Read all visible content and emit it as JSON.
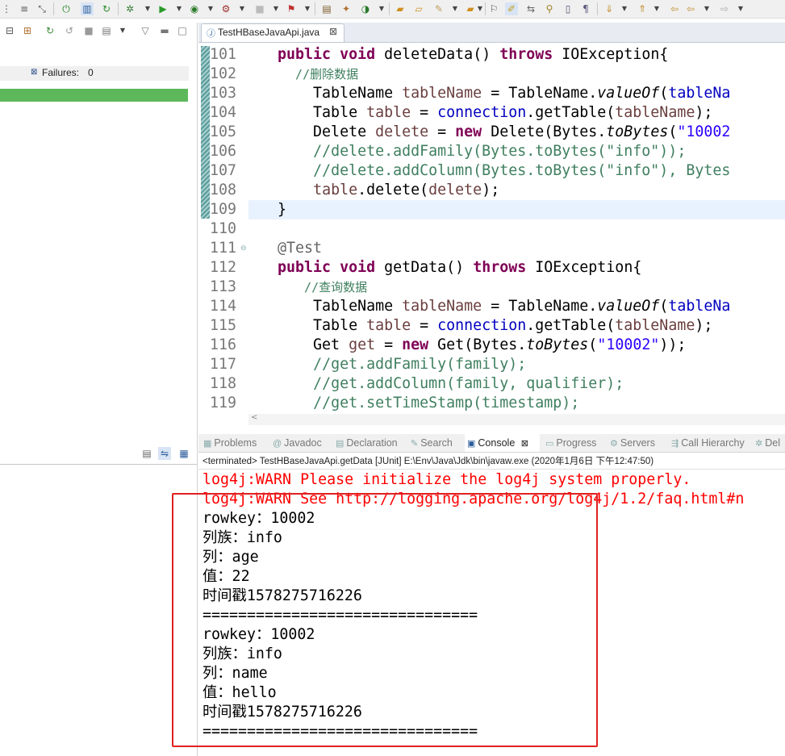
{
  "toolbar": {
    "icons": [
      "prev-edit-icon",
      "next-annotation-icon",
      "power-icon",
      "columns-icon",
      "refresh-icon",
      "debug-icon",
      "run-icon",
      "run-external-icon",
      "coverage-icon",
      "stop-icon",
      "new-server-icon",
      "pin-icon",
      "package-icon",
      "new-class-icon",
      "open-type-icon",
      "open-folder-icon",
      "search-icon",
      "task-icon",
      "open-icon",
      "bookmark-icon",
      "highlight-icon",
      "link-icon",
      "mark-icon",
      "block-icon",
      "pilcrow-icon",
      "next-arrow-icon",
      "prev-arrow-icon",
      "back-icon",
      "forward-icon"
    ]
  },
  "junit": {
    "failures_label": "Failures:",
    "failures_value": "0",
    "status_color": "#5db85c"
  },
  "editor": {
    "tab_title": "TestHBaseJavaApi.java",
    "tab_close": "⊠"
  },
  "code": {
    "lines": [
      {
        "n": "101",
        "t": "    public void deleteData() throws IOException{"
      },
      {
        "n": "102",
        "t": "      //删除数据"
      },
      {
        "n": "103",
        "t": "        TableName tableName = TableName.valueOf(tableNa"
      },
      {
        "n": "104",
        "t": "        Table table = connection.getTable(tableName);"
      },
      {
        "n": "105",
        "t": "        Delete delete = new Delete(Bytes.toBytes(\"10002"
      },
      {
        "n": "106",
        "t": "        //delete.addFamily(Bytes.toBytes(\"info\"));"
      },
      {
        "n": "107",
        "t": "        //delete.addColumn(Bytes.toBytes(\"info\"), Bytes"
      },
      {
        "n": "108",
        "t": "        table.delete(delete);"
      },
      {
        "n": "109",
        "t": "    }"
      },
      {
        "n": "110",
        "t": ""
      },
      {
        "n": "111",
        "t": "    @Test"
      },
      {
        "n": "112",
        "t": "    public void getData() throws IOException{"
      },
      {
        "n": "113",
        "t": "        //查询数据"
      },
      {
        "n": "114",
        "t": "        TableName tableName = TableName.valueOf(tableNa"
      },
      {
        "n": "115",
        "t": "        Table table = connection.getTable(tableName);"
      },
      {
        "n": "116",
        "t": "        Get get = new Get(Bytes.toBytes(\"10002\"));"
      },
      {
        "n": "117",
        "t": "        //get.addFamily(family);"
      },
      {
        "n": "118",
        "t": "        //get.addColumn(family, qualifier);"
      },
      {
        "n": "119",
        "t": "        //get.setTimeStamp(timestamp);"
      }
    ]
  },
  "panel": {
    "tabs": [
      "Problems",
      "Javadoc",
      "Declaration",
      "Search",
      "Console",
      "Progress",
      "Servers",
      "Call Hierarchy",
      "Del"
    ],
    "console_close": "⊠",
    "console_header": "<terminated> TestHBaseJavaApi.getData [JUnit] E:\\Env\\Java\\Jdk\\bin\\javaw.exe (2020年1月6日 下午12:47:50)"
  },
  "console": {
    "warn1": "log4j:WARN Please initialize the log4j system properly.",
    "warn2": "log4j:WARN See http://logging.apache.org/log4j/1.2/faq.html#n",
    "output": [
      "rowkey：10002",
      "列族：info",
      "列：age",
      "值：22",
      "时间戳1578275716226",
      "===============================",
      "rowkey：10002",
      "列族：info",
      "列：name",
      "值：hello",
      "时间戳1578275716226",
      "==============================="
    ]
  }
}
